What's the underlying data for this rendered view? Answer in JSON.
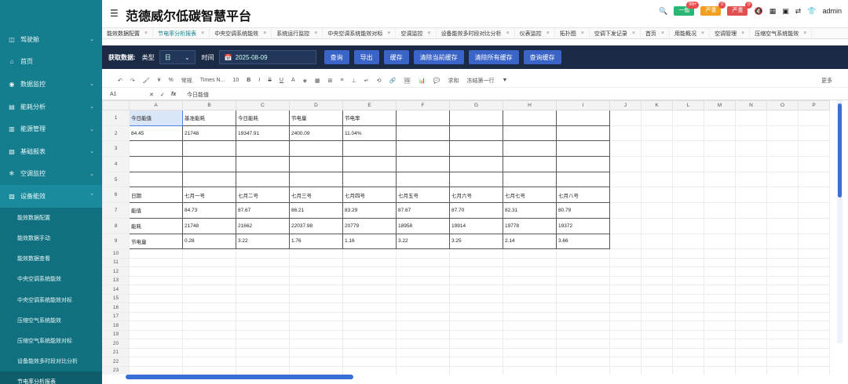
{
  "app": {
    "title": "范德威尔低碳智慧平台",
    "user": "admin"
  },
  "header": {
    "badges": [
      {
        "label": "一般",
        "count": "99+",
        "color": "#2bb673"
      },
      {
        "label": "严重",
        "count": "0",
        "color": "#f0a020"
      },
      {
        "label": "严重",
        "count": "0",
        "color": "#e05050"
      }
    ]
  },
  "sidebar": {
    "items": [
      {
        "label": "驾驶舱",
        "icon": "dashboard-icon",
        "chevron": true
      },
      {
        "label": "首页",
        "icon": "home-icon",
        "chevron": false
      },
      {
        "label": "数据监控",
        "icon": "monitor-icon",
        "chevron": true
      },
      {
        "label": "能耗分析",
        "icon": "analysis-icon",
        "chevron": true
      },
      {
        "label": "能源管理",
        "icon": "energy-icon",
        "chevron": true
      },
      {
        "label": "基础报表",
        "icon": "report-icon",
        "chevron": true
      },
      {
        "label": "空调监控",
        "icon": "snowflake-icon",
        "chevron": true
      },
      {
        "label": "设备能效",
        "icon": "device-icon",
        "chevron": true
      }
    ],
    "sub_items": [
      "能效数据配置",
      "能效数据手动",
      "能效数据查看",
      "中央空调系统能效",
      "中央空调系统能效对标",
      "压缩空气系统能效",
      "压缩空气系统能效对标",
      "设备能效多时段对比分析",
      "节电率分析报表"
    ]
  },
  "tabs": [
    "能效数据配置",
    "节电率分析报表",
    "中央空调系统能效",
    "系统运行监控",
    "中央空调系统能效对标",
    "空调监控",
    "设备能效多时段对比分析",
    "仪表监控",
    "拓扑图",
    "空调下发记录",
    "首页",
    "用能概况",
    "空调管理",
    "压缩空气系统能效"
  ],
  "toolbar": {
    "title": "获取数据:",
    "type_label": "类型",
    "type_value": "日",
    "time_label": "时间",
    "date_value": "2025-08-09",
    "buttons": [
      "查询",
      "导出",
      "缓存",
      "清除当前缓存",
      "清除所有缓存",
      "查询缓存"
    ]
  },
  "sheet_toolbar": {
    "font_family": "Times N...",
    "font_size": "10",
    "style": "常规",
    "sum": "求和",
    "freeze": "冻结第一行",
    "more": "更多"
  },
  "formula": {
    "cell": "A1",
    "content": "今日能值"
  },
  "columns": [
    "A",
    "B",
    "C",
    "D",
    "E",
    "F",
    "G",
    "H",
    "I",
    "J",
    "K",
    "L",
    "M",
    "N",
    "O",
    "P"
  ],
  "rows": [
    [
      "今日能值",
      "基准能耗",
      "今日能耗",
      "节电量",
      "节电率",
      "",
      "",
      "",
      ""
    ],
    [
      "84.45",
      "21748",
      "19347.91",
      "2400.09",
      "11.04%",
      "",
      "",
      "",
      ""
    ],
    [
      "",
      "",
      "",
      "",
      "",
      "",
      "",
      "",
      ""
    ],
    [
      "",
      "",
      "",
      "",
      "",
      "",
      "",
      "",
      ""
    ],
    [
      "",
      "",
      "",
      "",
      "",
      "",
      "",
      "",
      ""
    ],
    [
      "日期",
      "七月一号",
      "七月二号",
      "七月三号",
      "七月四号",
      "七月五号",
      "七月六号",
      "七月七号",
      "七月八号"
    ],
    [
      "能值",
      "84.73",
      "87.67",
      "86.21",
      "83.29",
      "87.67",
      "87.70",
      "82.31",
      "80.79"
    ],
    [
      "能耗",
      "21748",
      "21662",
      "22037.98",
      "20779",
      "18958",
      "19914",
      "19778",
      "19372"
    ],
    [
      "节电量",
      "0.28",
      "3.22",
      "1.76",
      "1.16",
      "3.22",
      "3.25",
      "2.14",
      "3.66"
    ]
  ],
  "empty_rows": [
    10,
    11,
    12,
    13,
    14,
    15,
    16,
    17,
    18,
    19,
    20,
    21,
    22,
    23
  ]
}
